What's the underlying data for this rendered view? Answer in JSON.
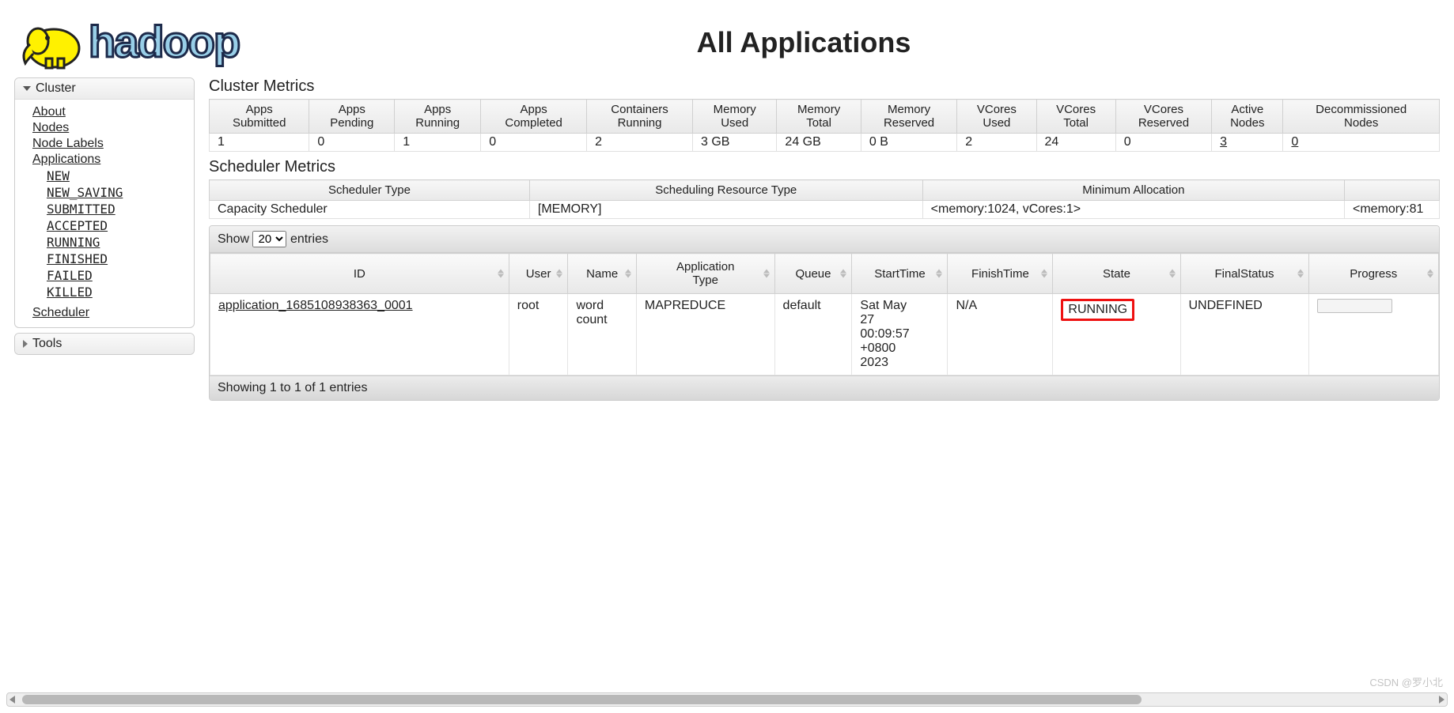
{
  "page_title": "All Applications",
  "logo_text": "hadoop",
  "sidebar": {
    "cluster": {
      "title": "Cluster",
      "links": [
        "About",
        "Nodes",
        "Node Labels",
        "Applications"
      ],
      "app_states": [
        "NEW",
        "NEW_SAVING",
        "SUBMITTED",
        "ACCEPTED",
        "RUNNING",
        "FINISHED",
        "FAILED",
        "KILLED"
      ],
      "scheduler": "Scheduler"
    },
    "tools": {
      "title": "Tools"
    }
  },
  "cluster_metrics": {
    "title": "Cluster Metrics",
    "headers": [
      "Apps Submitted",
      "Apps Pending",
      "Apps Running",
      "Apps Completed",
      "Containers Running",
      "Memory Used",
      "Memory Total",
      "Memory Reserved",
      "VCores Used",
      "VCores Total",
      "VCores Reserved",
      "Active Nodes",
      "Decommissioned Nodes"
    ],
    "row": [
      "1",
      "0",
      "1",
      "0",
      "2",
      "3 GB",
      "24 GB",
      "0 B",
      "2",
      "24",
      "0",
      "3",
      "0"
    ],
    "link_cols": [
      11,
      12
    ]
  },
  "scheduler_metrics": {
    "title": "Scheduler Metrics",
    "headers": [
      "Scheduler Type",
      "Scheduling Resource Type",
      "Minimum Allocation",
      ""
    ],
    "row": [
      "Capacity Scheduler",
      "[MEMORY]",
      "<memory:1024, vCores:1>",
      "<memory:81"
    ]
  },
  "apps_table": {
    "show_label_pre": "Show",
    "show_label_post": "entries",
    "show_value": "20",
    "headers": [
      "ID",
      "User",
      "Name",
      "Application Type",
      "Queue",
      "StartTime",
      "FinishTime",
      "State",
      "FinalStatus",
      "Progress"
    ],
    "rows": [
      {
        "id": "application_1685108938363_0001",
        "user": "root",
        "name": "word count",
        "app_type": "MAPREDUCE",
        "queue": "default",
        "start": "Sat May 27 00:09:57 +0800 2023",
        "finish": "N/A",
        "state": "RUNNING",
        "final": "UNDEFINED"
      }
    ],
    "info": "Showing 1 to 1 of 1 entries"
  },
  "watermark": "CSDN @罗小北"
}
